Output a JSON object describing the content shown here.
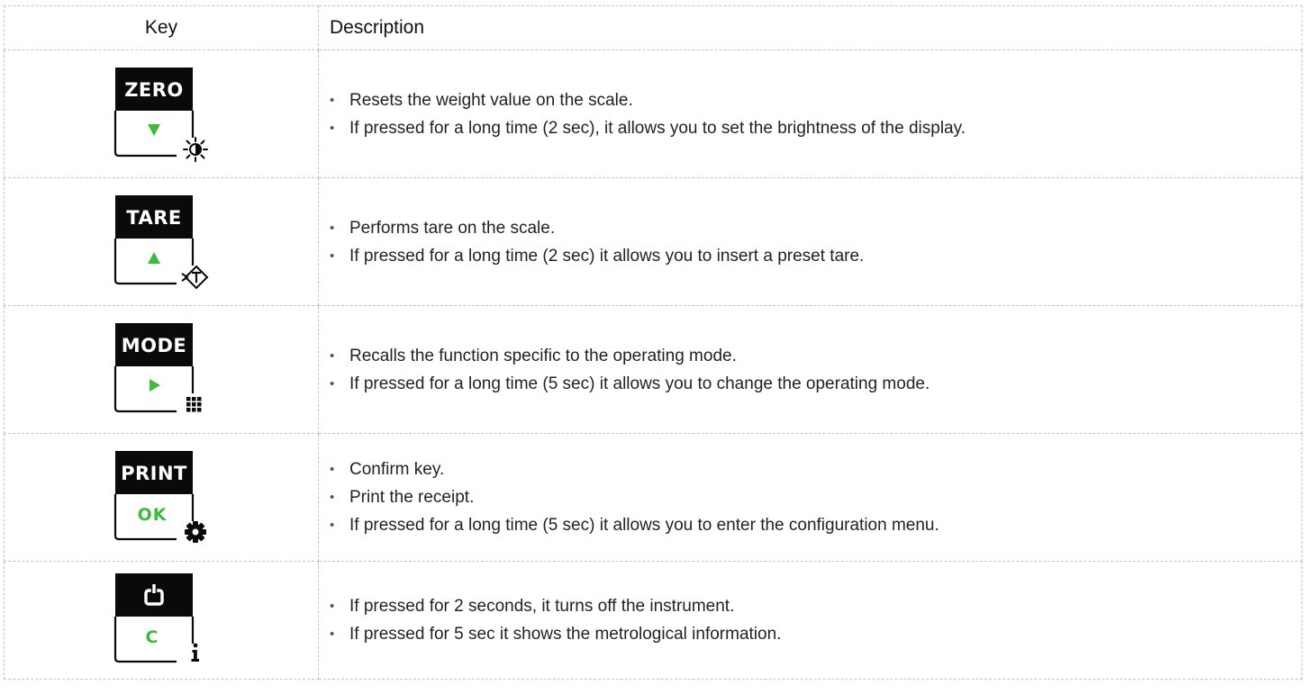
{
  "table": {
    "header": {
      "key": "Key",
      "description": "Description"
    },
    "rows": [
      {
        "key_label": "ZERO",
        "key_icon": "triangle-down-icon",
        "aux_icon": "brightness-icon",
        "description": [
          "Resets the weight value on the scale.",
          "If pressed for a long time (2 sec), it allows you to set the brightness of the display."
        ]
      },
      {
        "key_label": "TARE",
        "key_icon": "triangle-up-icon",
        "aux_icon": "preset-tare-icon",
        "description": [
          "Performs tare on the scale.",
          "If pressed for a long time (2 sec) it allows you to insert a preset tare."
        ]
      },
      {
        "key_label": "MODE",
        "key_icon": "triangle-right-icon",
        "aux_icon": "grid-icon",
        "description": [
          "Recalls the function specific to the operating mode.",
          "If pressed for a long time (5 sec) it allows you to change the operating mode."
        ]
      },
      {
        "key_label": "PRINT",
        "key_sub": "OK",
        "aux_icon": "gear-icon",
        "description": [
          "Confirm key.",
          "Print the receipt.",
          "If pressed for a long time (5 sec) it allows you to enter the configuration menu."
        ]
      },
      {
        "key_icon_top": "power-icon",
        "key_sub": "C",
        "aux_icon": "info-icon",
        "description": [
          "If pressed for 2 seconds, it turns off the instrument.",
          "If pressed for 5 sec it shows the metrological information."
        ]
      }
    ]
  },
  "colors": {
    "key_black": "#0a0a0a",
    "key_green": "#3bbd3b",
    "border": "#c4c4c4"
  }
}
